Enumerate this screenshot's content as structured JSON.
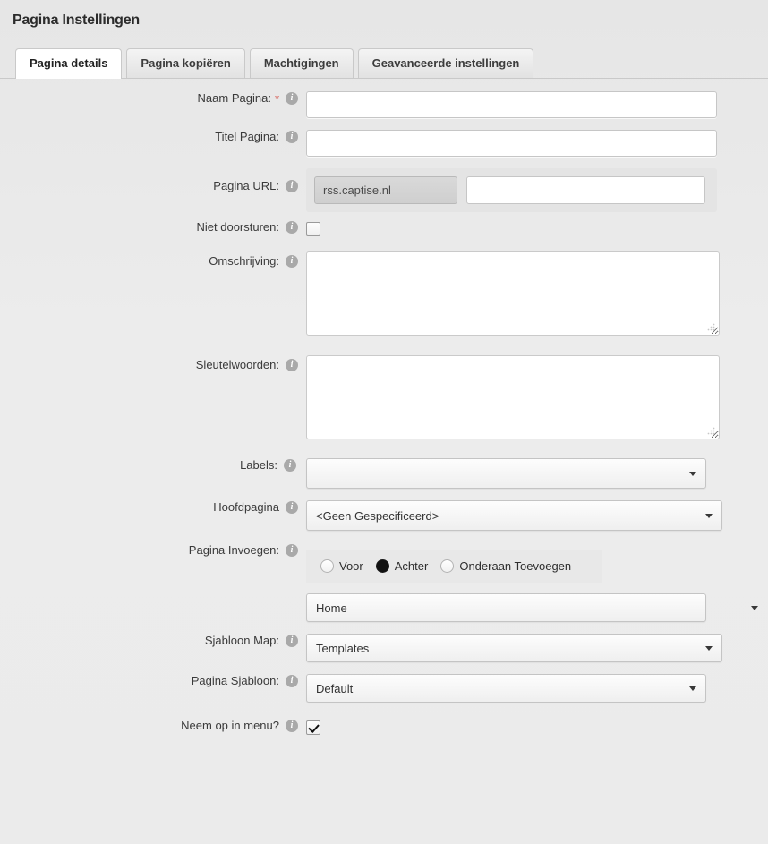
{
  "header": {
    "title": "Pagina Instellingen"
  },
  "tabs": [
    {
      "label": "Pagina details",
      "active": true
    },
    {
      "label": "Pagina kopiëren",
      "active": false
    },
    {
      "label": "Machtigingen",
      "active": false
    },
    {
      "label": "Geavanceerde instellingen",
      "active": false
    }
  ],
  "form": {
    "page_name": {
      "label": "Naam Pagina:",
      "required": true,
      "value": "",
      "placeholder": ""
    },
    "page_title": {
      "label": "Titel Pagina:",
      "required": false,
      "value": "",
      "placeholder": ""
    },
    "page_url": {
      "label": "Pagina URL:",
      "prefix": "rss.captise.nl",
      "value": "",
      "placeholder": ""
    },
    "no_redirect": {
      "label": "Niet doorsturen:",
      "checked": false
    },
    "description": {
      "label": "Omschrijving:",
      "value": "",
      "placeholder": ""
    },
    "keywords": {
      "label": "Sleutelwoorden:",
      "value": "",
      "placeholder": ""
    },
    "labels": {
      "label": "Labels:",
      "value": "",
      "options": [
        ""
      ]
    },
    "parent_page": {
      "label": "Hoofdpagina",
      "value": "<Geen Gespecificeerd>",
      "options": [
        "<Geen Gespecificeerd>"
      ]
    },
    "insert_page": {
      "label": "Pagina Invoegen:",
      "radios": [
        {
          "label": "Voor",
          "checked": false
        },
        {
          "label": "Achter",
          "checked": true
        },
        {
          "label": "Onderaan Toevoegen",
          "checked": false
        }
      ],
      "target": {
        "value": "Home",
        "options": [
          "Home"
        ]
      }
    },
    "template_dir": {
      "label": "Sjabloon Map:",
      "value": "Templates",
      "options": [
        "Templates"
      ]
    },
    "page_template": {
      "label": "Pagina Sjabloon:",
      "value": "Default",
      "options": [
        "Default"
      ]
    },
    "in_menu": {
      "label": "Neem op in menu?",
      "checked": true
    }
  },
  "colors": {
    "background": "#ebebeb",
    "required_star": "#d23a32",
    "info_icon": "#a9a9a9",
    "tab_border": "#c9c9c9",
    "active_tab_bg": "#ffffff"
  }
}
